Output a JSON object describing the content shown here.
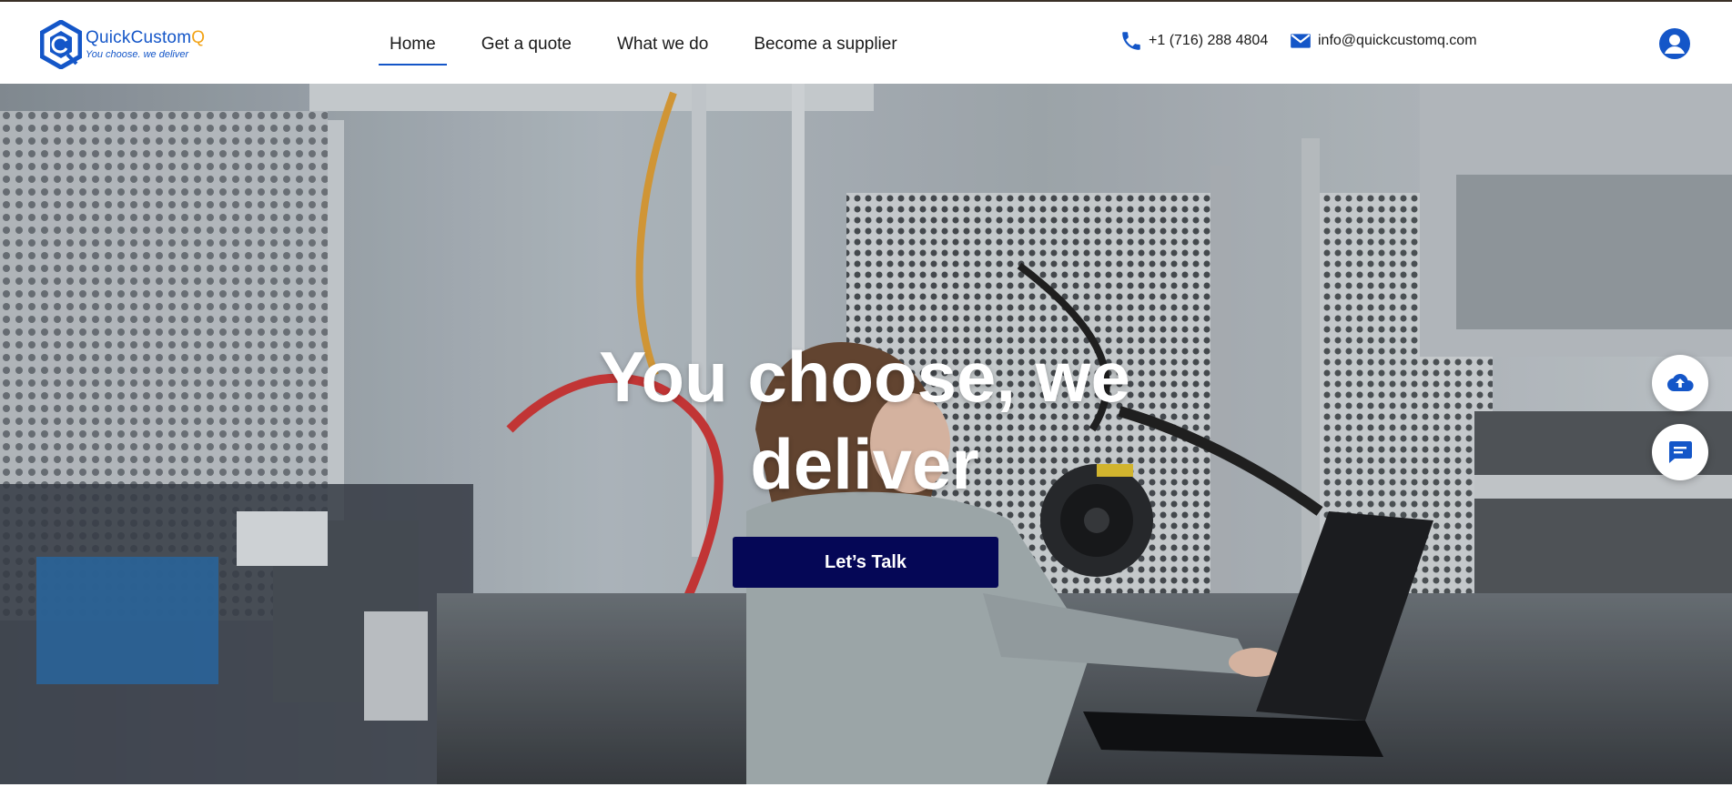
{
  "header": {
    "logo": {
      "name_main": "QuickCustom",
      "name_accent": "Q",
      "tagline": "You choose. we deliver",
      "icon": "hexagon-q-logo-icon"
    },
    "nav": {
      "items": [
        {
          "label": "Home",
          "active": true
        },
        {
          "label": "Get a quote",
          "active": false
        },
        {
          "label": "What we do",
          "active": false
        },
        {
          "label": "Become a supplier",
          "active": false
        }
      ]
    },
    "contact": {
      "phone": "+1 (716) 288 4804",
      "phone_icon": "phone-icon",
      "email": "info@quickcustomq.com",
      "email_icon": "mail-icon"
    },
    "account_icon": "user-account-icon"
  },
  "hero": {
    "title": "You choose, we deliver",
    "cta_label": "Let’s Talk",
    "background": "photo of woman working on laptop in electronics lab"
  },
  "floating_actions": [
    {
      "icon": "cloud-upload-icon"
    },
    {
      "icon": "chat-icon"
    }
  ],
  "colors": {
    "brand_blue": "#1456c8",
    "brand_accent": "#f2a316",
    "cta_navy": "#050756",
    "text": "#1a1a1a"
  }
}
